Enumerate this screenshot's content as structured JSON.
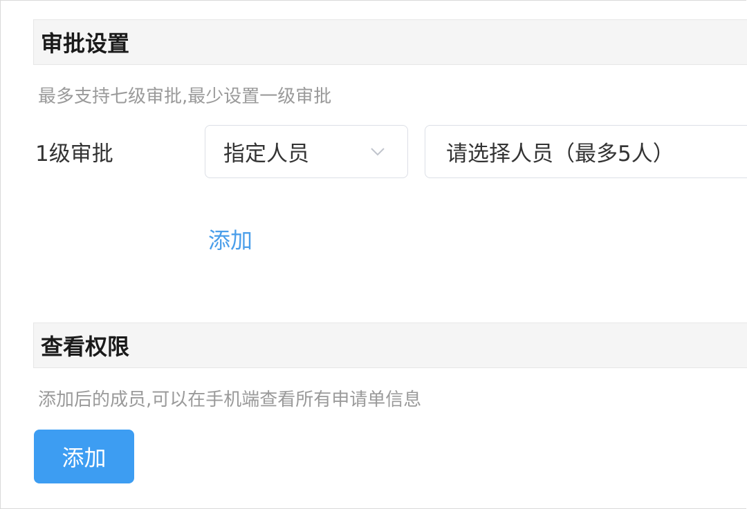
{
  "approval_settings": {
    "title": "审批设置",
    "hint": "最多支持七级审批,最少设置一级审批",
    "levels": [
      {
        "label": "1级审批",
        "approver_type": "指定人员",
        "people_placeholder": "请选择人员（最多5人）"
      }
    ],
    "add_link_label": "添加"
  },
  "view_permission": {
    "title": "查看权限",
    "hint": "添加后的成员,可以在手机端查看所有申请单信息",
    "add_button_label": "添加"
  },
  "colors": {
    "accent": "#3d9df2",
    "link": "#4a9eea",
    "header_bg": "#f5f5f5",
    "hint_text": "#9a9a9a"
  },
  "icons": {
    "select_arrow": "chevron-down-icon"
  }
}
